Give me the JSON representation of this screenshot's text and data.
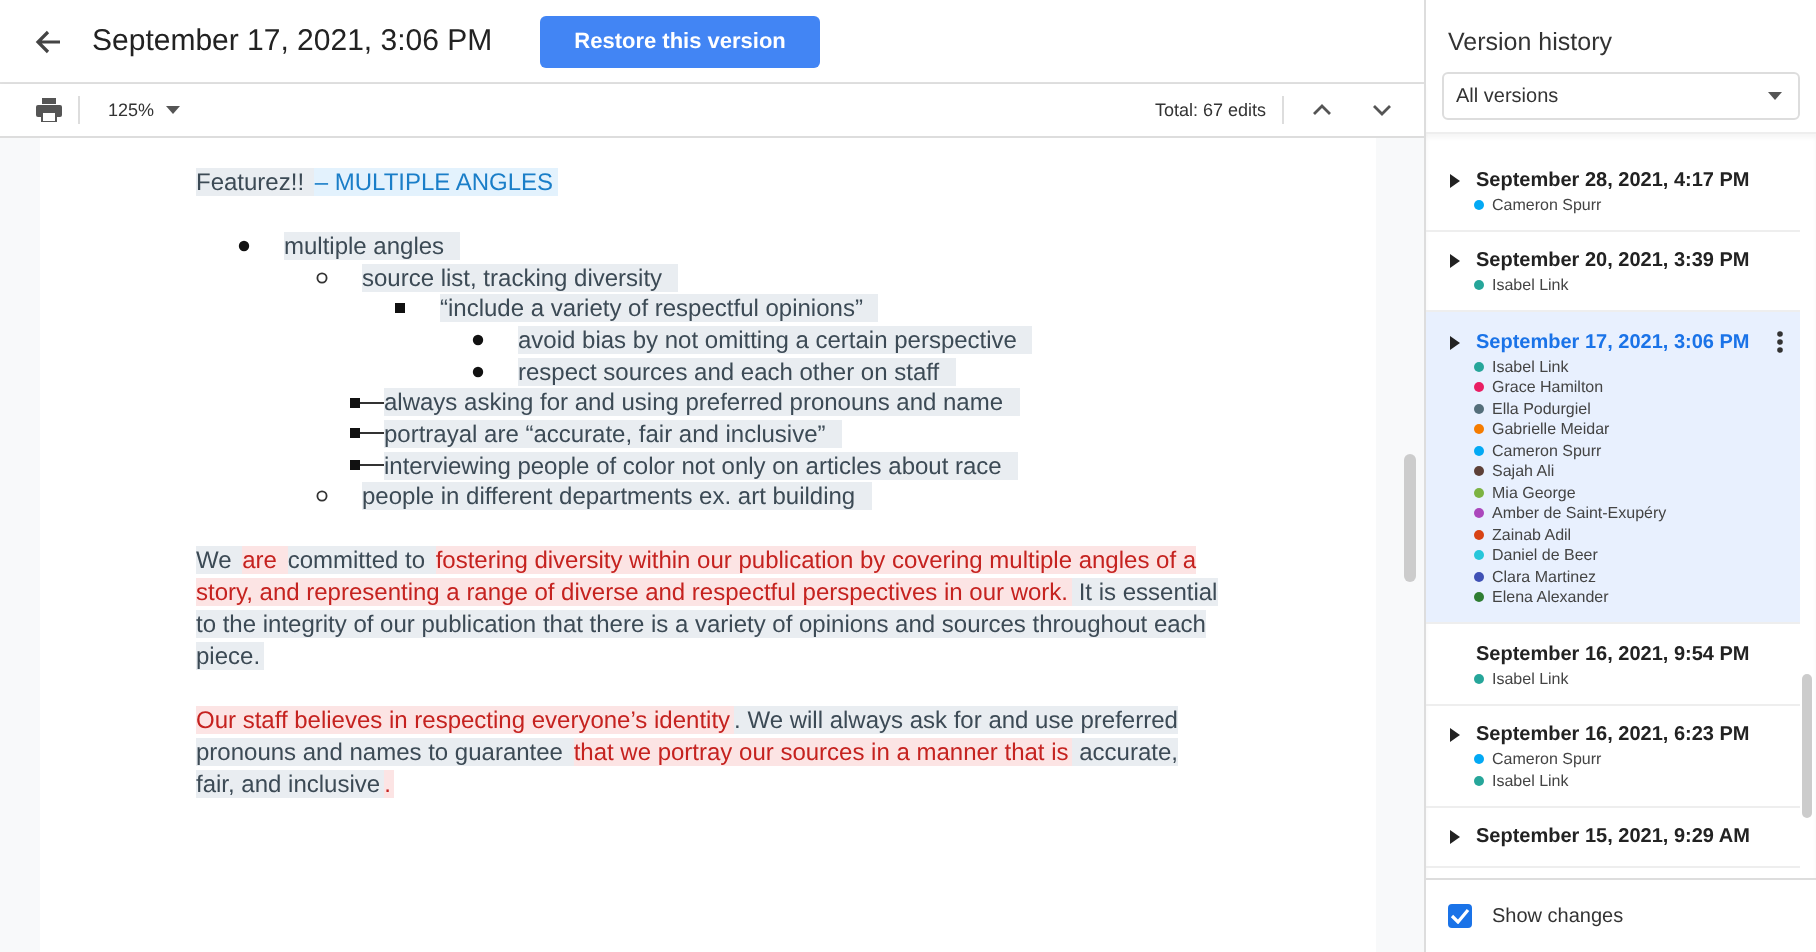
{
  "header": {
    "title": "September 17, 2021, 3:06 PM",
    "restore_button": "Restore this version"
  },
  "toolbar": {
    "zoom": "125%",
    "total_edits": "Total: 67 edits"
  },
  "document": {
    "heading": [
      {
        "text": "Featurez!! ",
        "kind": "plain"
      },
      {
        "text": "– MULTIPLE ANGLES",
        "kind": "blue"
      }
    ],
    "list": [
      {
        "text": "multiple angles",
        "kind": "normal",
        "children": [
          {
            "text": "source list, tracking diversity",
            "kind": "normal",
            "children": [
              {
                "text": "“include a variety of respectful opinions”",
                "kind": "normal",
                "children": [
                  {
                    "text": "avoid bias by not omitting a certain perspective",
                    "kind": "normal"
                  },
                  {
                    "text": "respect sources and each other on staff",
                    "kind": "normal"
                  }
                ]
              },
              {
                "text": "always asking for and using preferred pronouns and name",
                "kind": "moved"
              },
              {
                "text": "portrayal are “accurate, fair and inclusive”",
                "kind": "moved"
              },
              {
                "text": "interviewing people of color not only on articles about race",
                "kind": "moved"
              }
            ]
          },
          {
            "text": "people in different departments ex. art building",
            "kind": "normal"
          }
        ]
      }
    ],
    "paragraphs": [
      [
        {
          "text": "We ",
          "kind": "plain"
        },
        {
          "text": "are ",
          "kind": "added"
        },
        {
          "text": "committed to ",
          "kind": "plain"
        },
        {
          "text": "fostering diversity within our publication by covering multiple angles of a story, and representing a range of diverse and respectful perspectives in our work.",
          "kind": "added"
        },
        {
          "text": " It is essential to the integrity of our publication that there is a variety of opinions and sources throughout each piece.",
          "kind": "plain"
        }
      ],
      [
        {
          "text": "Our staff believes in respecting everyone’s identity",
          "kind": "added"
        },
        {
          "text": ". We will always ask for and use preferred pronouns and names to guarantee ",
          "kind": "plain"
        },
        {
          "text": "that we portray our sources in a manner that is",
          "kind": "added"
        },
        {
          "text": " accurate, fair, and inclusive",
          "kind": "plain"
        },
        {
          "text": ".",
          "kind": "added"
        }
      ]
    ]
  },
  "panel": {
    "title": "Version history",
    "filter": "All versions",
    "versions": [
      {
        "date": "September 28, 2021, 4:17 PM",
        "expandable": true,
        "selected": false,
        "authors": [
          {
            "name": "Cameron Spurr",
            "color": "#03a9f4"
          }
        ]
      },
      {
        "date": "September 20, 2021, 3:39 PM",
        "expandable": true,
        "selected": false,
        "authors": [
          {
            "name": "Isabel Link",
            "color": "#26a69a"
          }
        ]
      },
      {
        "date": "September 17, 2021, 3:06 PM",
        "expandable": true,
        "selected": true,
        "authors": [
          {
            "name": "Isabel Link",
            "color": "#26a69a"
          },
          {
            "name": "Grace Hamilton",
            "color": "#e91e63"
          },
          {
            "name": "Ella Podurgiel",
            "color": "#546e7a"
          },
          {
            "name": "Gabrielle Meidar",
            "color": "#f57c00"
          },
          {
            "name": "Cameron Spurr",
            "color": "#03a9f4"
          },
          {
            "name": "Sajah Ali",
            "color": "#5d4037"
          },
          {
            "name": "Mia George",
            "color": "#7cb342"
          },
          {
            "name": "Amber de Saint-Exupéry",
            "color": "#ab47bc"
          },
          {
            "name": "Zainab Adil",
            "color": "#d84315"
          },
          {
            "name": "Daniel de Beer",
            "color": "#26c6da"
          },
          {
            "name": "Clara Martinez",
            "color": "#3f51b5"
          },
          {
            "name": "Elena Alexander",
            "color": "#2e7d32"
          }
        ]
      },
      {
        "date": "September 16, 2021, 9:54 PM",
        "expandable": false,
        "selected": false,
        "authors": [
          {
            "name": "Isabel Link",
            "color": "#26a69a"
          }
        ]
      },
      {
        "date": "September 16, 2021, 6:23 PM",
        "expandable": true,
        "selected": false,
        "authors": [
          {
            "name": "Cameron Spurr",
            "color": "#03a9f4"
          },
          {
            "name": "Isabel Link",
            "color": "#26a69a"
          }
        ]
      },
      {
        "date": "September 15, 2021, 9:29 AM",
        "expandable": true,
        "selected": false
      }
    ],
    "show_changes": {
      "label": "Show changes",
      "checked": true
    }
  }
}
